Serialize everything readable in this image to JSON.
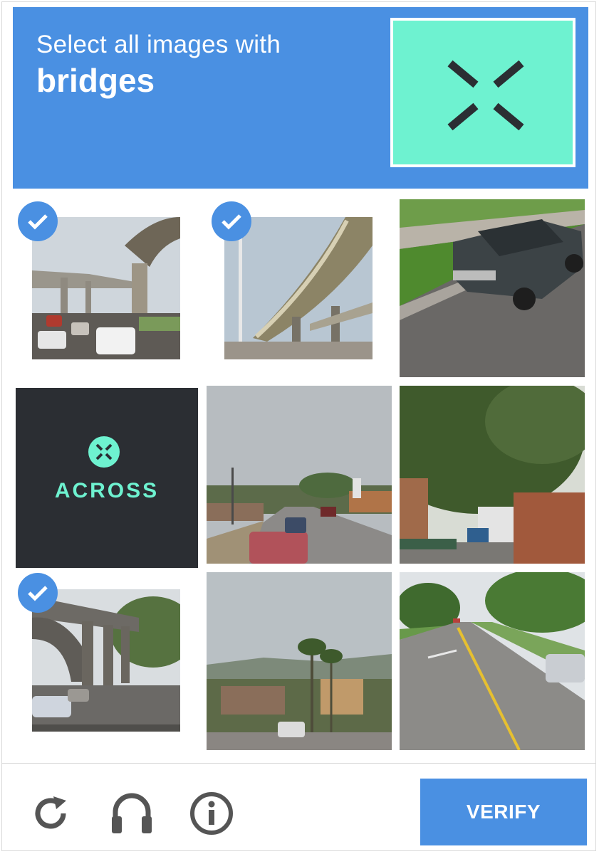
{
  "header": {
    "prompt_line1": "Select all images with",
    "prompt_target": "bridges",
    "sample_icon": "close-x-icon",
    "sample_color": "#6ef2d0"
  },
  "grid": {
    "tiles": [
      {
        "content": "highway overpass with traffic",
        "selected": true
      },
      {
        "content": "curved overpass with light pole",
        "selected": true
      },
      {
        "content": "parked green SUV on street",
        "selected": false
      },
      {
        "content": "ACROSS logo tile",
        "selected": false,
        "label": "ACROSS"
      },
      {
        "content": "street with red car and traffic light",
        "selected": false
      },
      {
        "content": "tree and brick building",
        "selected": false
      },
      {
        "content": "arched concrete bridge over highway",
        "selected": true
      },
      {
        "content": "street with palm trees and hills",
        "selected": false
      },
      {
        "content": "tree-lined road",
        "selected": false
      }
    ]
  },
  "footer": {
    "reload_icon": "reload-icon",
    "audio_icon": "headphones-icon",
    "info_icon": "info-icon",
    "verify_label": "VERIFY"
  },
  "colors": {
    "accent": "#4a90e2",
    "mint": "#6ef2d0",
    "dark_tile": "#2b2e33",
    "icon_gray": "#555555"
  }
}
